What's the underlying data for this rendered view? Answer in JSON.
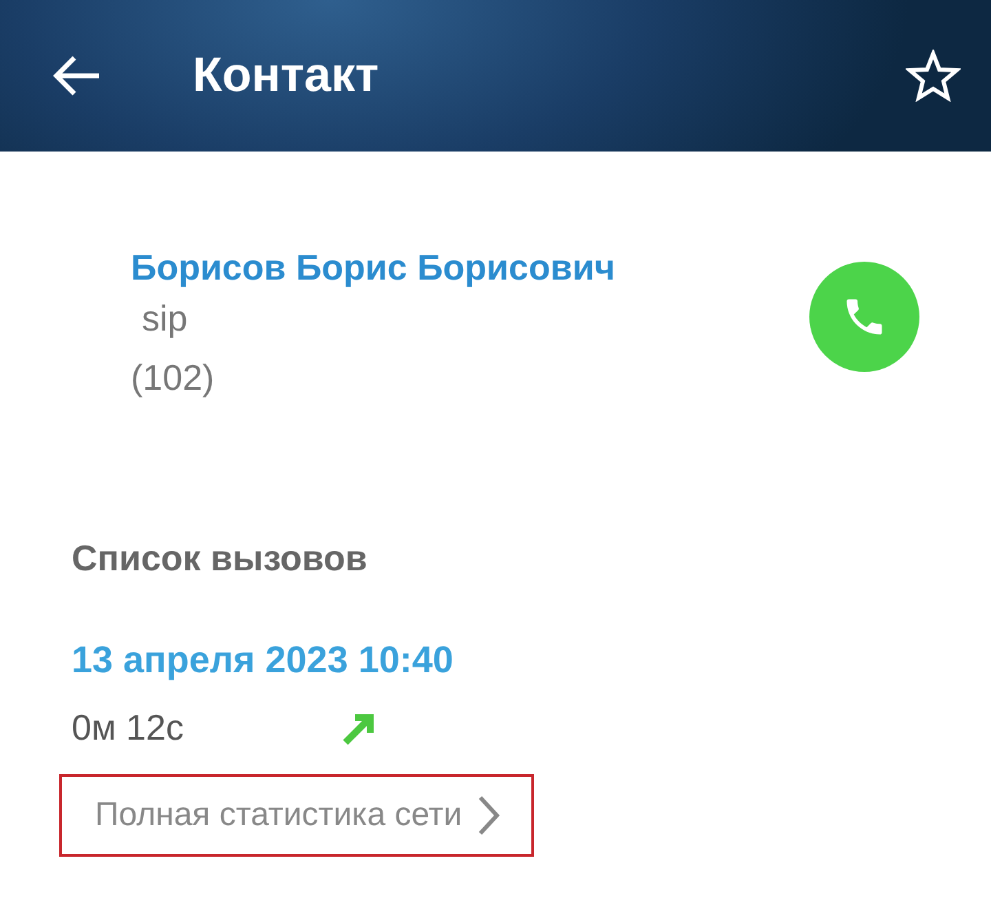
{
  "header": {
    "title": "Контакт"
  },
  "contact": {
    "name": "Борисов Борис Борисович",
    "type": "sip",
    "number": "(102)"
  },
  "calls": {
    "heading": "Список вызовов",
    "items": [
      {
        "date": "13 апреля 2023 10:40",
        "duration": "0м 12с",
        "kind": "outgoing"
      }
    ]
  },
  "stats_link": {
    "label": "Полная статистика сети",
    "highlighted": true
  }
}
